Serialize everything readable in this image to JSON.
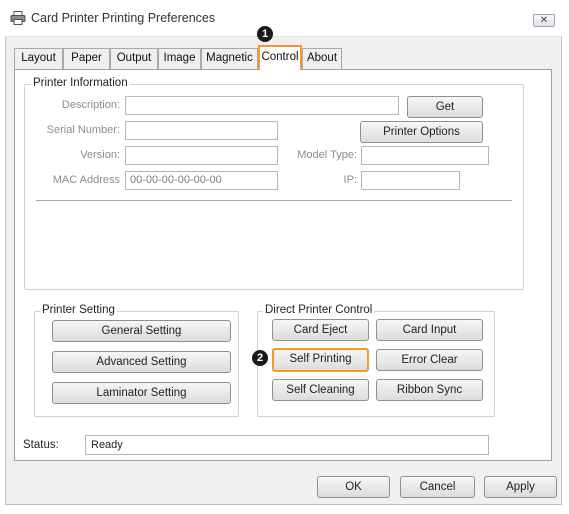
{
  "window": {
    "title": "Card Printer Printing Preferences",
    "close_glyph": "✕"
  },
  "tabs": [
    {
      "label": "Layout"
    },
    {
      "label": "Paper"
    },
    {
      "label": "Output"
    },
    {
      "label": "Image"
    },
    {
      "label": "Magnetic"
    },
    {
      "label": "Control",
      "active": true
    },
    {
      "label": "About"
    }
  ],
  "markers": {
    "first": "1",
    "second": "2"
  },
  "printer_info": {
    "legend": "Printer Information",
    "description_label": "Description:",
    "description_value": "",
    "get_button": "Get",
    "serial_label": "Serial Number:",
    "serial_value": "",
    "printer_options_button": "Printer Options",
    "version_label": "Version:",
    "version_value": "",
    "model_type_label": "Model Type:",
    "model_type_value": "",
    "mac_label": "MAC Address",
    "mac_value": "00-00-00-00-00-00",
    "ip_label": "IP:",
    "ip_value": ""
  },
  "printer_setting": {
    "legend": "Printer Setting",
    "general": "General Setting",
    "advanced": "Advanced Setting",
    "laminator": "Laminator Setting"
  },
  "direct_control": {
    "legend": "Direct Printer Control",
    "card_eject": "Card Eject",
    "card_input": "Card Input",
    "self_printing": "Self Printing",
    "error_clear": "Error Clear",
    "self_cleaning": "Self Cleaning",
    "ribbon_sync": "Ribbon Sync"
  },
  "status": {
    "label": "Status:",
    "value": "Ready"
  },
  "footer": {
    "ok": "OK",
    "cancel": "Cancel",
    "apply": "Apply"
  },
  "colors": {
    "highlight": "#f39a2b",
    "marker": "#1a1a1a"
  },
  "icons": {
    "window": "printer-icon"
  }
}
